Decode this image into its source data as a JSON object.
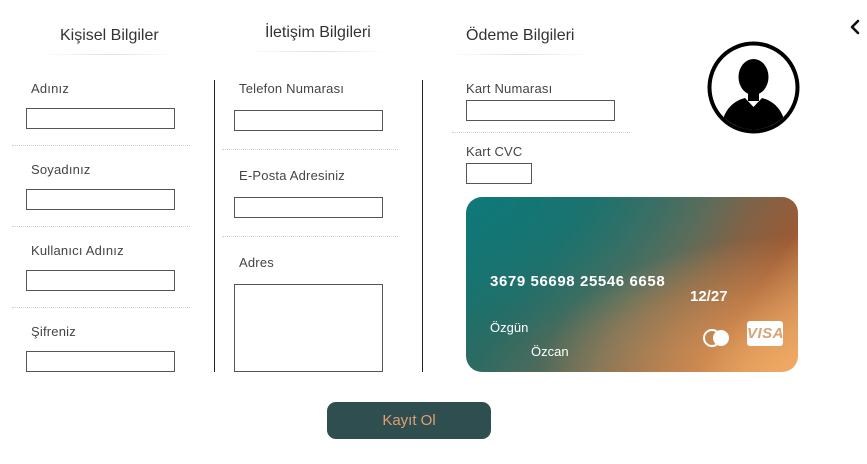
{
  "personal": {
    "title": "Kişisel Bilgiler",
    "first_name_label": "Adınız",
    "last_name_label": "Soyadınız",
    "username_label": "Kullanıcı Adınız",
    "password_label": "Şifreniz"
  },
  "contact": {
    "title": "İletişim Bilgileri",
    "phone_label": "Telefon Numarası",
    "email_label": "E-Posta Adresiniz",
    "address_label": "Adres"
  },
  "payment": {
    "title": "Ödeme Bilgileri",
    "card_number_label": "Kart Numarası",
    "cvc_label": "Kart CVC"
  },
  "card": {
    "number": "3679 56698 25546 6658",
    "expiry": "12/27",
    "first_name": "Özgün",
    "last_name": "Özcan",
    "brand": "VISA"
  },
  "submit_label": "Kayıt Ol",
  "colors": {
    "button_bg": "#2e4e4f",
    "button_text": "#e0a070",
    "card_gradient_start": "#0f7572",
    "card_gradient_end": "#e8a060"
  },
  "icons": [
    "chevron-left-icon",
    "user-avatar-icon",
    "mastercard-icon",
    "visa-icon"
  ]
}
